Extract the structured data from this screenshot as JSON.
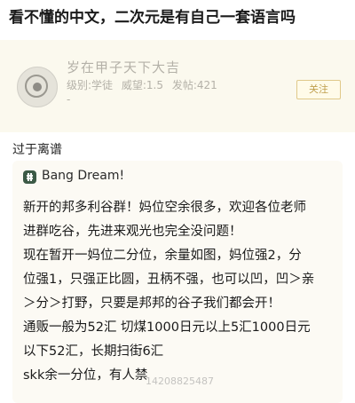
{
  "post_title": "看不懂的中文，二次元是有自己一套语言吗",
  "forum_user": {
    "name": "岁在甲子天下大吉",
    "level": "级别:学徒",
    "prestige": "威望:1.5",
    "posts": "发帖:421",
    "dash": "-",
    "follow_label": "关注"
  },
  "caption": "过于离谱",
  "group": {
    "name": "Bang Dream!",
    "message_lines": [
      "新开的邦多利谷群！妈位空余很多，欢迎各位老师",
      "进群吃谷，先进来观光也完全没问题！",
      "现在暂开一妈位二分位，余量如图，妈位强2，分",
      "位强1，只强正比圆，丑柄不强，也可以凹，凹＞亲",
      "＞分＞打野，只要是邦邦的谷子我们都会开！",
      "通贩一般为52汇 切煤1000日元以上5汇1000日元",
      "以下52汇，长期扫街6汇",
      "skk余一分位，有人禁"
    ]
  },
  "watermark": "14208825487"
}
